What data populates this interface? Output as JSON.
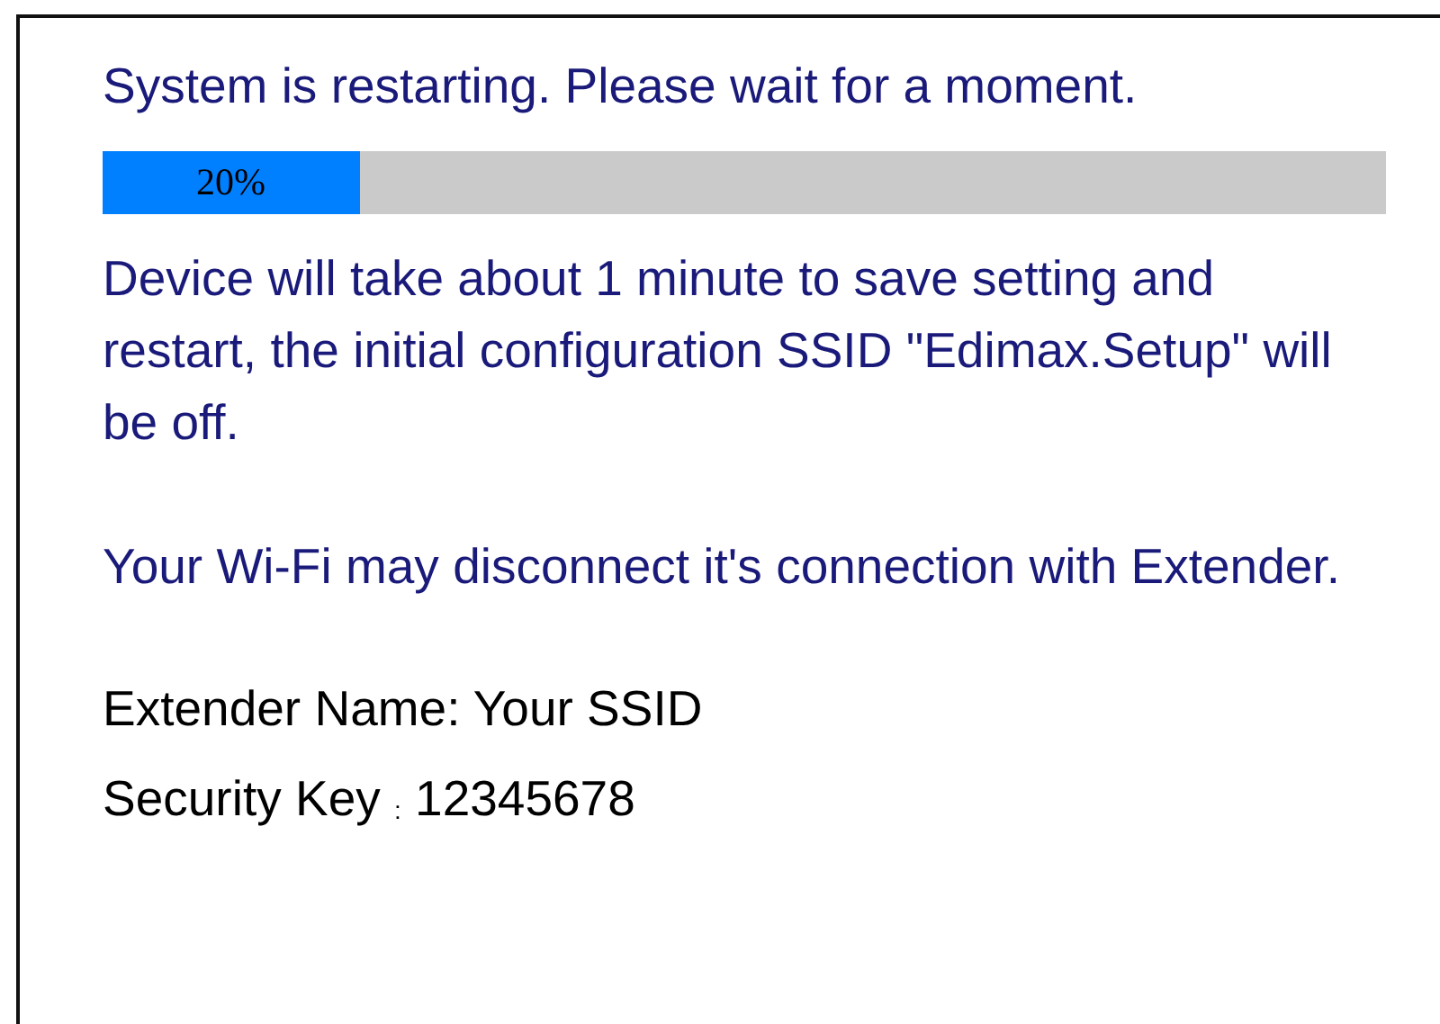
{
  "heading": "System is restarting. Please wait for a moment.",
  "progress": {
    "level": 0.2,
    "label": "20%"
  },
  "messages": [
    "Device will take about 1 minute to save setting and restart, the initial configuration SSID \"Edimax.Setup\" will be off.",
    "Your Wi-Fi may disconnect it's connection with Extender."
  ],
  "details": [
    "Extender Name: Your SSID",
    "Security Key $_{:}$ 12345678"
  ]
}
